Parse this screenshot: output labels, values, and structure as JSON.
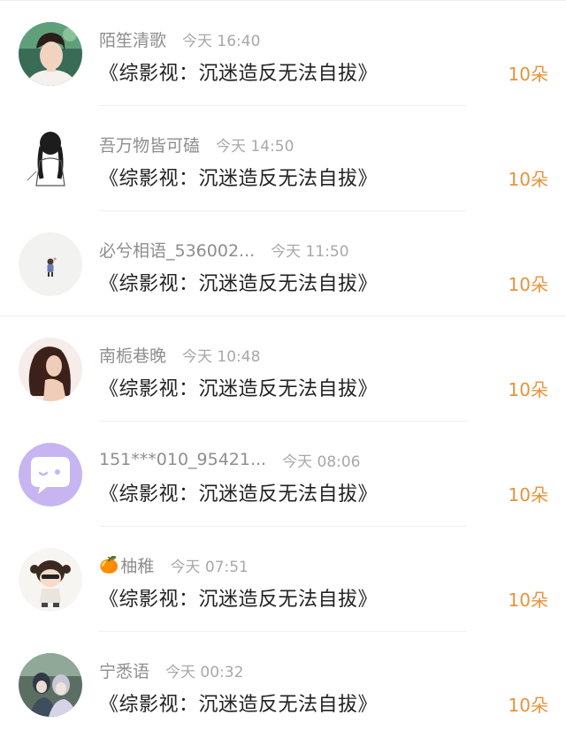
{
  "accent_color": "#e9923a",
  "items": [
    {
      "username": "陌笙清歌",
      "time": "今天 16:40",
      "title": "《综影视：沉迷造反无法自拔》",
      "count": "10朵",
      "avatar": "young-man-portrait"
    },
    {
      "username": "吾万物皆可磕",
      "time": "今天 14:50",
      "title": "《综影视：沉迷造反无法自拔》",
      "count": "10朵",
      "avatar": "braided-girl-sketch"
    },
    {
      "username": "必兮相语_536002...",
      "time": "今天 11:50",
      "title": "《综影视：沉迷造反无法自拔》",
      "count": "10朵",
      "avatar": "tiny-figure"
    },
    {
      "username": "南栀巷晚",
      "time": "今天 10:48",
      "title": "《综影视：沉迷造反无法自拔》",
      "count": "10朵",
      "avatar": "woman-long-hair"
    },
    {
      "username": "151***010_95421...",
      "time": "今天 08:06",
      "title": "《综影视：沉迷造反无法自拔》",
      "count": "10朵",
      "avatar": "chat-bubble-default"
    },
    {
      "username": "柚稚",
      "emoji": "🍊",
      "time": "今天 07:51",
      "title": "《综影视：沉迷造反无法自拔》",
      "count": "10朵",
      "avatar": "cartoon-girl"
    },
    {
      "username": "宁悉语",
      "time": "今天 00:32",
      "title": "《综影视：沉迷造反无法自拔》",
      "count": "10朵",
      "avatar": "anime-illustration"
    }
  ]
}
